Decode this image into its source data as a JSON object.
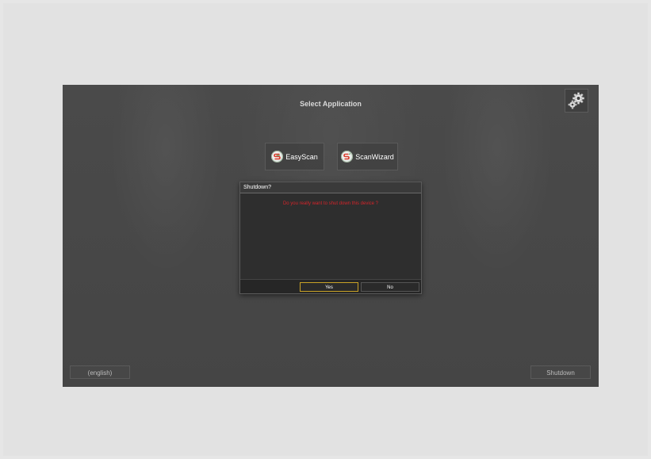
{
  "screen": {
    "title": "Select Application",
    "settings_icon": "gears-icon"
  },
  "apps": [
    {
      "name": "EasyScan",
      "icon": "easyscan-logo-icon"
    },
    {
      "name": "ScanWizard",
      "icon": "scanwizard-logo-icon"
    }
  ],
  "dialog": {
    "title": "Shutdown?",
    "message": "Do you really want to shut down this device ?",
    "yes_label": "Yes",
    "no_label": "No"
  },
  "footer": {
    "language_label": "(english)",
    "shutdown_label": "Shutdown"
  },
  "colors": {
    "accent_border": "#c9a227",
    "message_red": "#d4242a",
    "background": "#484848"
  }
}
